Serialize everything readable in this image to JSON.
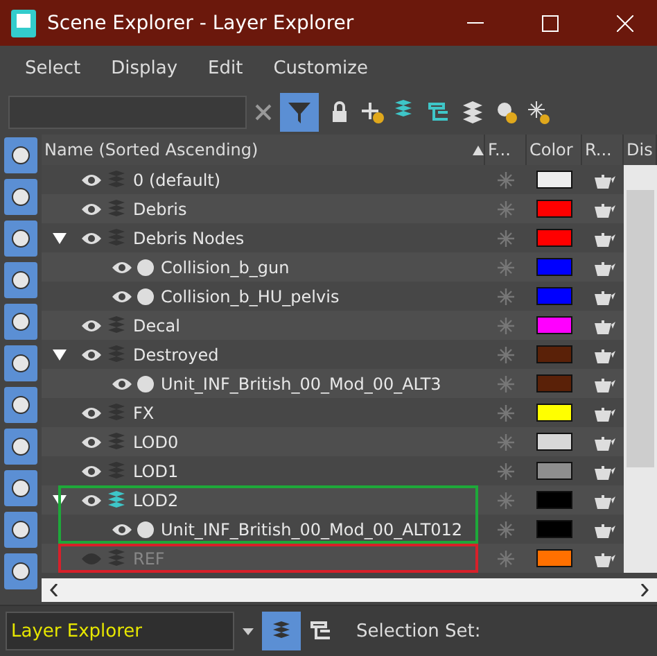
{
  "window": {
    "title": "Scene Explorer - Layer Explorer"
  },
  "menu": [
    "Select",
    "Display",
    "Edit",
    "Customize"
  ],
  "filter_active": true,
  "columns": [
    "Name (Sorted Ascending)",
    "F...",
    "Color",
    "R...",
    "Dis"
  ],
  "rows": [
    {
      "name": "0 (default)",
      "kind": "layer",
      "color": "#eeeeee",
      "current": false,
      "hidden": false
    },
    {
      "name": "Debris",
      "kind": "layer",
      "color": "#ff0000",
      "current": false,
      "hidden": false
    },
    {
      "name": "Debris Nodes",
      "kind": "layer",
      "color": "#ff0000",
      "current": false,
      "hidden": false,
      "expanded": true,
      "children": [
        {
          "name": "Collision_b_gun",
          "kind": "object",
          "color": "#0000ff",
          "hidden": false
        },
        {
          "name": "Collision_b_HU_pelvis",
          "kind": "object",
          "color": "#0000ff",
          "hidden": false
        }
      ]
    },
    {
      "name": "Decal",
      "kind": "layer",
      "color": "#ff00ff",
      "current": false,
      "hidden": false
    },
    {
      "name": "Destroyed",
      "kind": "layer",
      "color": "#5a2108",
      "current": false,
      "hidden": false,
      "expanded": true,
      "children": [
        {
          "name": "Unit_INF_British_00_Mod_00_ALT3",
          "kind": "object",
          "color": "#5a2108",
          "hidden": false
        }
      ]
    },
    {
      "name": "FX",
      "kind": "layer",
      "color": "#ffff00",
      "current": false,
      "hidden": false
    },
    {
      "name": "LOD0",
      "kind": "layer",
      "color": "#d8d8d8",
      "current": false,
      "hidden": false
    },
    {
      "name": "LOD1",
      "kind": "layer",
      "color": "#8e8e8e",
      "current": false,
      "hidden": false
    },
    {
      "name": "LOD2",
      "kind": "layer",
      "color": "#000000",
      "current": true,
      "hidden": false,
      "expanded": true,
      "highlight": {
        "color": "#1ea83a"
      },
      "children": [
        {
          "name": "Unit_INF_British_00_Mod_00_ALT012",
          "kind": "object",
          "color": "#000000",
          "hidden": false
        }
      ]
    },
    {
      "name": "REF",
      "kind": "layer",
      "color": "#ff7000",
      "current": false,
      "hidden": true,
      "highlight": {
        "color": "#d8202a"
      }
    }
  ],
  "footer": {
    "explorer": "Layer Explorer",
    "selection_set_label": "Selection Set:"
  }
}
